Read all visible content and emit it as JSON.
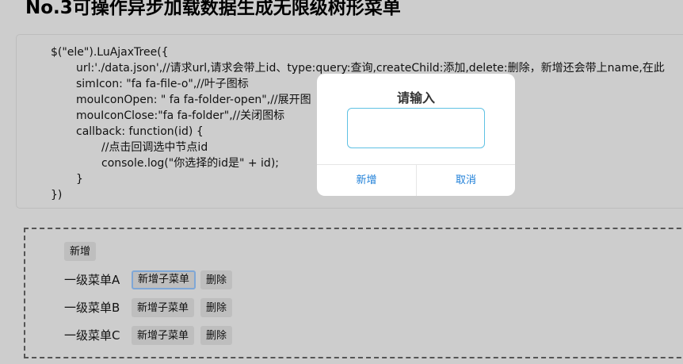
{
  "page": {
    "title": "No.3可操作异步加载数据生成无限级树形菜单"
  },
  "code": {
    "lines": [
      "$(\"ele\").LuAjaxTree({",
      "url:'./data.json',//请求url,请求会带上id、type:query:查询,createChild:添加,delete:删除，新增还会带上name,在此",
      "simIcon: \"fa fa-file-o\",//叶子图标",
      "mouIconOpen: \" fa fa-folder-open\",//展开图",
      "mouIconClose:\"fa fa-folder\",//关闭图标",
      "callback: function(id) {",
      "//点击回调选中节点id",
      "console.log(\"你选择的id是\" + id);",
      "}",
      "})"
    ]
  },
  "tree": {
    "add_label": "新增",
    "items": [
      {
        "label": "一级菜单A",
        "add_child_label": "新增子菜单",
        "delete_label": "删除"
      },
      {
        "label": "一级菜单B",
        "add_child_label": "新增子菜单",
        "delete_label": "删除"
      },
      {
        "label": "一级菜单C",
        "add_child_label": "新增子菜单",
        "delete_label": "删除"
      }
    ]
  },
  "dialog": {
    "title": "请输入",
    "input_value": "",
    "confirm_label": "新增",
    "cancel_label": "取消"
  },
  "colors": {
    "background": "#cdcdcd",
    "dialog_button": "#1e7fd8",
    "input_border": "#5fc1e3"
  }
}
